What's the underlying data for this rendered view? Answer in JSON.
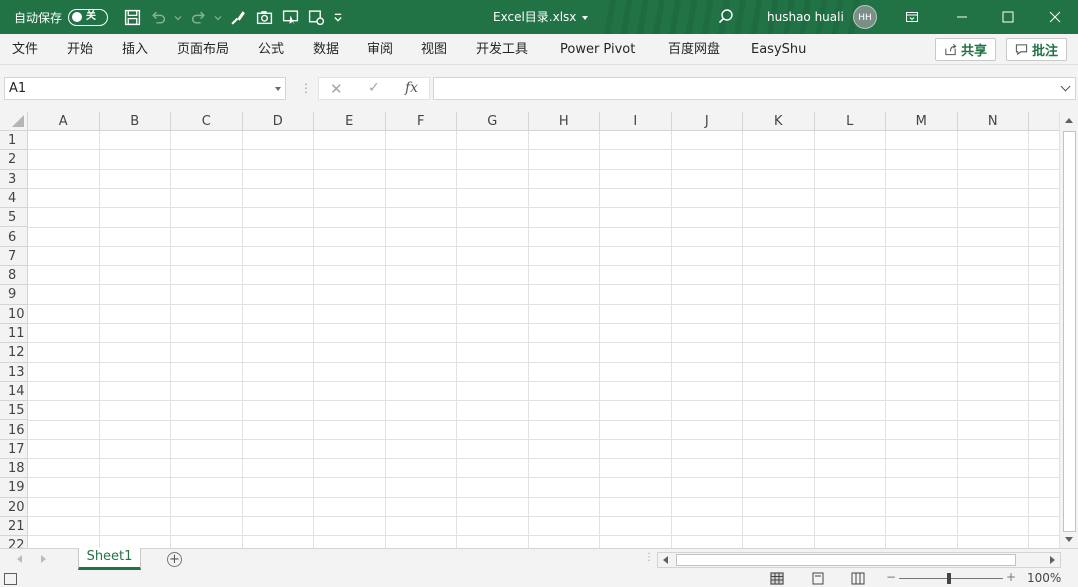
{
  "titlebar": {
    "autosave_label": "自动保存",
    "autosave_state": "关",
    "file_title": "Excel目录.xlsx",
    "user_name": "hushao huali",
    "avatar_initials": "HH",
    "bg_color": "#217346"
  },
  "menu": {
    "items": [
      "文件",
      "开始",
      "插入",
      "页面布局",
      "公式",
      "数据",
      "审阅",
      "视图",
      "开发工具",
      "Power Pivot",
      "百度网盘",
      "EasyShu"
    ],
    "share_label": "共享",
    "comment_label": "批注"
  },
  "formula_bar": {
    "name_box": "A1",
    "fx_label": "fx",
    "formula_value": ""
  },
  "grid": {
    "columns": [
      "A",
      "B",
      "C",
      "D",
      "E",
      "F",
      "G",
      "H",
      "I",
      "J",
      "K",
      "L",
      "M",
      "N"
    ],
    "rows": [
      "1",
      "2",
      "3",
      "4",
      "5",
      "6",
      "7",
      "8",
      "9",
      "10",
      "11",
      "12",
      "13",
      "14",
      "15",
      "16",
      "17",
      "18",
      "19",
      "20",
      "21",
      "22"
    ]
  },
  "sheets": {
    "tabs": [
      "Sheet1"
    ],
    "add_label": "+"
  },
  "status": {
    "zoom_level": "100%",
    "zoom_minus": "−",
    "zoom_plus": "+"
  }
}
